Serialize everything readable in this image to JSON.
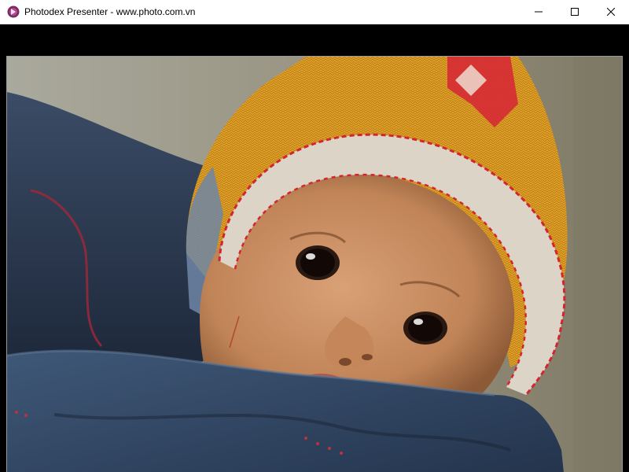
{
  "window": {
    "title": "Photodex Presenter - www.photo.com.vn",
    "controls": {
      "minimize": "minimize",
      "maximize": "maximize",
      "close": "close"
    }
  },
  "viewer": {
    "image_subject": "baby-portrait-photo",
    "colors": {
      "hat_yellow": "#e3a52a",
      "hat_trim": "#d9d2c6",
      "hat_red": "#d8262c",
      "carrier_blue": "#2c3e57",
      "background": "#8f8c7c",
      "skin": "#c98f63"
    }
  }
}
